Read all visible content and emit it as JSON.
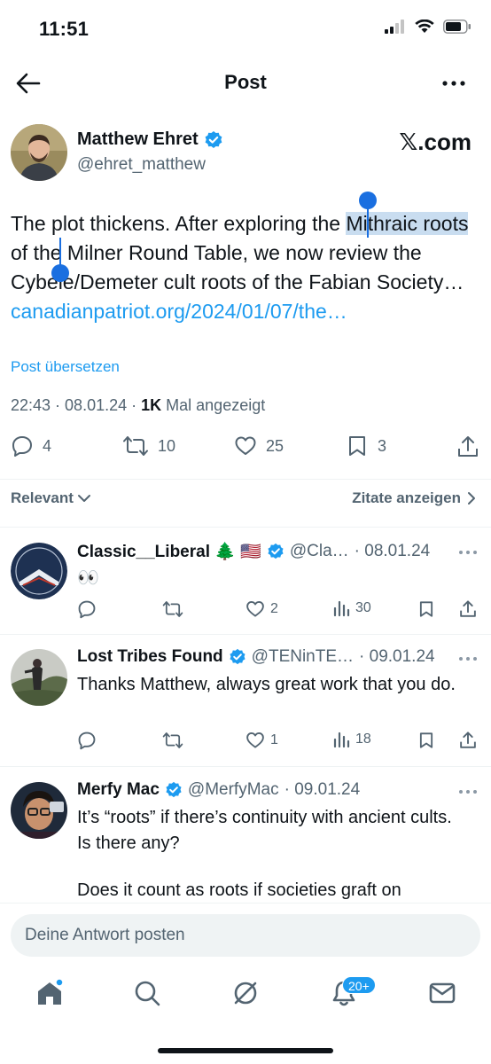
{
  "status_bar": {
    "time": "11:51"
  },
  "header": {
    "title": "Post"
  },
  "author": {
    "name": "Matthew Ehret",
    "handle": "@ehret_matthew",
    "verified": true,
    "brand": "𝕏.com"
  },
  "tweet": {
    "text_before": "The plot thickens. After exploring the ",
    "text_highlight": "Mithraic roots",
    "text_after": " of the Milner Round Table, we now review the Cybele/Demeter cult roots of the Fabian Society… ",
    "link": "canadianpatriot.org/2024/01/07/the…",
    "translate_label": "Post übersetzen",
    "time": "22:43",
    "date": "08.01.24",
    "views_count": "1K",
    "views_label": "Mal angezeigt"
  },
  "tweet_actions": {
    "replies": "4",
    "reposts": "10",
    "likes": "25",
    "bookmarks": "3"
  },
  "sort": {
    "relevant_label": "Relevant",
    "quotes_label": "Zitate anzeigen"
  },
  "replies": [
    {
      "name": "Classic__Liberal 🌲 🇺🇸",
      "handle": "@Cla…",
      "date": "· 08.01.24",
      "text": "👀",
      "replies": "",
      "reposts": "",
      "likes": "2",
      "views": "30"
    },
    {
      "name": "Lost Tribes Found",
      "handle": "@TENinTE…",
      "date": "· 09.01.24",
      "text": "Thanks Matthew, always great work that you do.",
      "replies": "",
      "reposts": "",
      "likes": "1",
      "views": "18"
    },
    {
      "name": "Merfy Mac",
      "handle": "@MerfyMac",
      "date": "· 09.01.24",
      "text_1": "It’s “roots” if there’s continuity with ancient cults. Is there any?",
      "text_2": "Does it count as roots if societies graft on"
    }
  ],
  "compose": {
    "placeholder": "Deine Antwort posten"
  },
  "nav": {
    "notifications_badge": "20+"
  },
  "colors": {
    "accent": "#1d9bf0",
    "text": "#0f1419",
    "muted": "#536471",
    "highlight": "#c9ddf0"
  }
}
